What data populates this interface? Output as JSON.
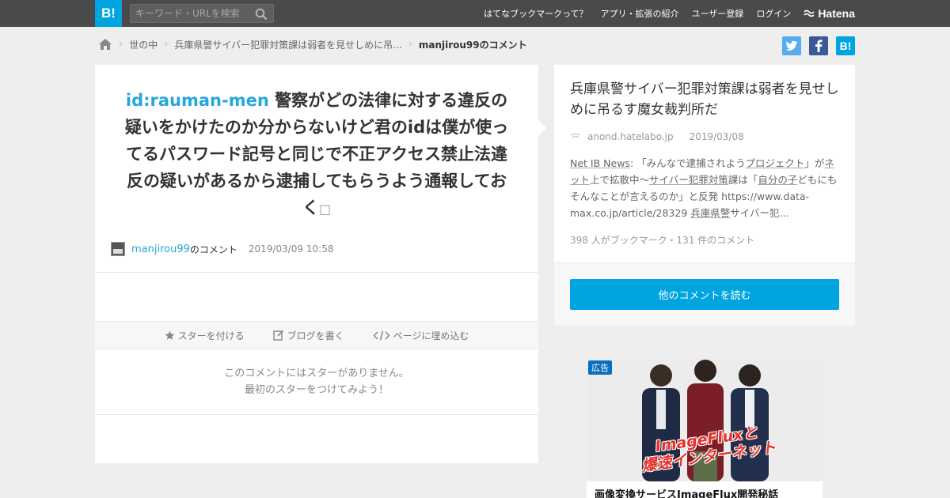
{
  "header": {
    "logo": "B!",
    "search_placeholder": "キーワード・URLを検索",
    "nav": [
      "はてなブックマークって？",
      "アプリ・拡張の紹介",
      "ユーザー登録",
      "ログイン"
    ],
    "brand": "Hatena"
  },
  "breadcrumb": {
    "items": [
      "世の中",
      "兵庫県警サイバー犯罪対策課は弱者を見せしめに吊...",
      "manjirou99のコメント"
    ]
  },
  "share": {
    "twitter": "twitter-icon",
    "facebook": "facebook-icon",
    "hatena": "B!"
  },
  "comment": {
    "user_id": "id:rauman-men",
    "text": "警察がどの法律に対する違反の疑いをかけたのか分からないけど君のidは僕が使ってるパスワード記号と同じで不正アクセス禁止法違反の疑いがあるから逮捕してもらうよう通報しておく",
    "trailing_glyph": "□",
    "author": "manjirou99",
    "author_suffix": "のコメント",
    "date": "2019/03/09 10:58"
  },
  "actions": {
    "star": "スターを付ける",
    "blog": "ブログを書く",
    "embed": "ページに埋め込む"
  },
  "stars": {
    "line1": "このコメントにはスターがありません。",
    "line2": "最初のスターをつけてみよう！"
  },
  "entry": {
    "title": "兵庫県警サイバー犯罪対策課は弱者を見せしめに吊るす魔女裁判所だ",
    "domain": "anond.hatelabo.jp",
    "date": "2019/03/08",
    "summary": {
      "p1": "Net IB News",
      "p2": ": 「みんなで逮捕されよう",
      "p3": "プロジェクト",
      "p4": "」が",
      "p5": "ネット",
      "p6": "上で拡散中～",
      "p7": "サイバー犯罪対策",
      "p8": "課は「",
      "p9": "自分の子",
      "p10": "どもにもそんなことが言えるのか」と反発 https://www.data-max.co.jp/article/28329 ",
      "p11": "兵庫県警",
      "p12": "サイバー犯..."
    },
    "stats": "398 人がブックマーク・131 件のコメント",
    "button": "他のコメントを読む"
  },
  "ad": {
    "tag": "広告",
    "art_line1": "ImageFluxと",
    "art_line2": "爆速インターネット",
    "caption": "画像変換サービスImageFlux開発秘話"
  },
  "colors": {
    "topbar": "#4a4a4a",
    "accent": "#00a4de",
    "link": "#25a7d8",
    "twitter": "#55acee",
    "facebook": "#3b5998"
  }
}
